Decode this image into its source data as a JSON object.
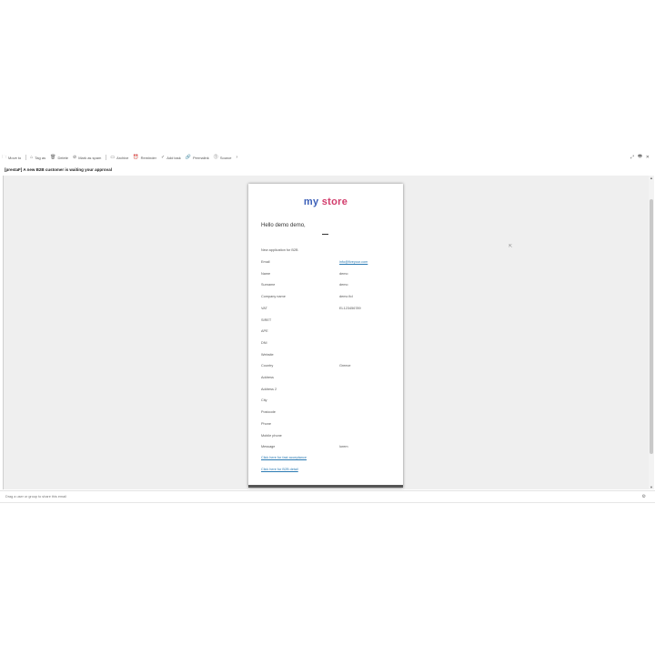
{
  "toolbar": {
    "items": [
      {
        "icon": "folder-move-icon",
        "glyph": "🗀",
        "label": "Move to"
      },
      {
        "icon": "tag-icon",
        "glyph": "⌂",
        "label": "Tag as"
      },
      {
        "icon": "trash-icon",
        "glyph": "🗑",
        "label": "Delete"
      },
      {
        "icon": "spam-icon",
        "glyph": "⊘",
        "label": "Mark as spam"
      },
      {
        "icon": "archive-icon",
        "glyph": "▭",
        "label": "Archive"
      },
      {
        "icon": "reminder-icon",
        "glyph": "⏰",
        "label": "Reminder"
      },
      {
        "icon": "add-task-icon",
        "glyph": "✓",
        "label": "Add task"
      },
      {
        "icon": "permalink-icon",
        "glyph": "🔗",
        "label": "Permalink"
      },
      {
        "icon": "source-icon",
        "glyph": "⓵",
        "label": "Source"
      },
      {
        "icon": "more-icon",
        "glyph": "›",
        "label": ""
      }
    ],
    "right_glyphs": [
      "⤢",
      "🖶",
      "✕"
    ]
  },
  "email": {
    "subject": "[prestaF] A new B2B customer is waiting your approval",
    "logo_word1": "my",
    "logo_word2": "store",
    "greeting": "Hello demo demo,",
    "intro": "New application for B2B",
    "fields": [
      {
        "label": "Email",
        "value": "info@fiveyour.com",
        "link": true
      },
      {
        "label": "Name",
        "value": "demo"
      },
      {
        "label": "Surname",
        "value": "demo"
      },
      {
        "label": "Company name",
        "value": "demo ltd"
      },
      {
        "label": "VAT",
        "value": "EL123456789"
      },
      {
        "label": "SIRET",
        "value": ""
      },
      {
        "label": "APE",
        "value": ""
      },
      {
        "label": "DNI",
        "value": ""
      },
      {
        "label": "Website",
        "value": ""
      },
      {
        "label": "Country",
        "value": "Greece"
      },
      {
        "label": "Address",
        "value": ""
      },
      {
        "label": "Address 2",
        "value": ""
      },
      {
        "label": "City",
        "value": ""
      },
      {
        "label": "Postcode",
        "value": ""
      },
      {
        "label": "Phone",
        "value": ""
      },
      {
        "label": "Mobile phone",
        "value": ""
      },
      {
        "label": "Message",
        "value": "lorem"
      }
    ],
    "link_accept": "Click here for fast acceptance",
    "link_detail": "Click here for B2B detail"
  },
  "footer": {
    "hint": "Drag a user or group to share this email"
  }
}
